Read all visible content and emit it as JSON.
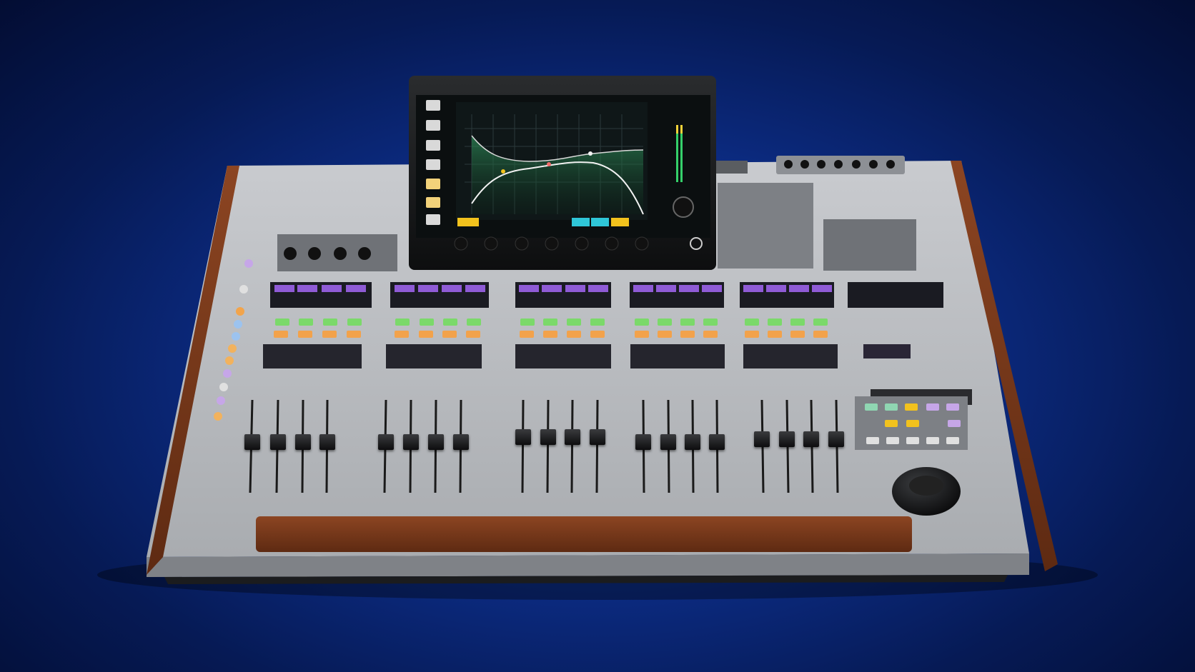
{
  "colors": {
    "background": "#0d2f8c",
    "console_body": "#b8bbbf",
    "wood": "#7a3a1c",
    "screen_bg": "#0b0f10",
    "eq_curve": "#f2f2f2",
    "meter_green": "#35d06a",
    "accent_cyan": "#2fc6d8",
    "accent_yellow": "#f2c21d"
  },
  "screen": {
    "eq_display": "graph",
    "sidebar_icons": [
      "home-icon",
      "library-icon",
      "routing-icon",
      "effects-icon",
      "meters-icon",
      "setup-icon",
      "view-icon"
    ],
    "encoder_count": 7
  },
  "console": {
    "fader_banks": 5,
    "faders_per_bank": 4,
    "fader_levels": [
      0.55,
      0.55,
      0.55,
      0.55,
      0.55,
      0.55,
      0.55,
      0.55,
      0.6,
      0.6,
      0.6,
      0.6,
      0.55,
      0.55,
      0.55,
      0.55,
      0.58,
      0.58,
      0.58,
      0.58
    ],
    "jog_wheel": "jog-wheel"
  }
}
